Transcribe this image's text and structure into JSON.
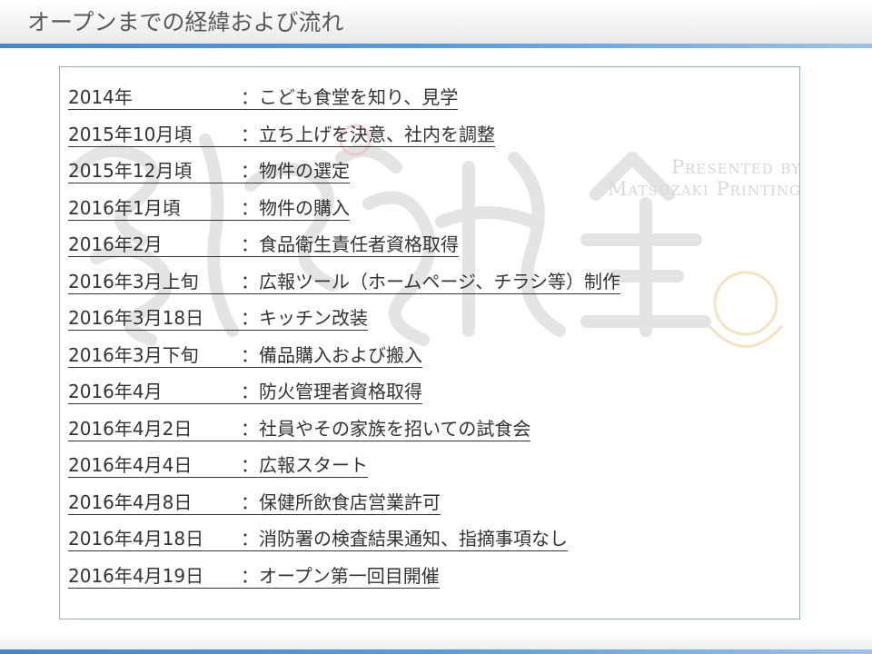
{
  "header": {
    "title": "オープンまでの経緯および流れ"
  },
  "watermark": {
    "line1": "Presented by",
    "line2": "Matsuzaki Printing"
  },
  "separator": "：",
  "timeline": [
    {
      "date": "2014年",
      "event": "こども食堂を知り、見学"
    },
    {
      "date": "2015年10月頃",
      "event": "立ち上げを決意、社内を調整"
    },
    {
      "date": "2015年12月頃",
      "event": "物件の選定"
    },
    {
      "date": "2016年1月頃",
      "event": "物件の購入"
    },
    {
      "date": "2016年2月",
      "event": "食品衛生責任者資格取得"
    },
    {
      "date": "2016年3月上旬",
      "event": "広報ツール（ホームページ、チラシ等）制作"
    },
    {
      "date": "2016年3月18日",
      "event": "キッチン改装"
    },
    {
      "date": "2016年3月下旬",
      "event": "備品購入および搬入"
    },
    {
      "date": "2016年4月",
      "event": "防火管理者資格取得"
    },
    {
      "date": "2016年4月2日",
      "event": "社員やその家族を招いての試食会"
    },
    {
      "date": "2016年4月4日",
      "event": "広報スタート"
    },
    {
      "date": "2016年4月8日",
      "event": "保健所飲食店営業許可"
    },
    {
      "date": "2016年4月18日",
      "event": "消防署の検査結果通知、指摘事項なし"
    },
    {
      "date": "2016年4月19日",
      "event": "オープン第一回目開催"
    }
  ],
  "colors": {
    "accent": "#5b9bd5",
    "text": "#333333",
    "title": "#595959",
    "border": "#9aa9c4"
  }
}
